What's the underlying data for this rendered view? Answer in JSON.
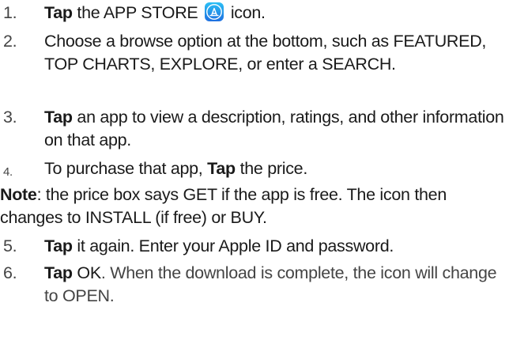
{
  "steps": [
    {
      "number": "1.",
      "parts": [
        "Tap",
        " the APP STORE ",
        " icon."
      ],
      "icon": "app-store-icon"
    },
    {
      "number": "2.",
      "text": "Choose a browse option at the bottom, such as FEATURED, TOP CHARTS, EXPLORE, or enter a SEARCH."
    },
    {
      "number": "3.",
      "parts": [
        "Tap",
        " an app to view a description, ratings, and other information on that app."
      ]
    },
    {
      "number": "4.",
      "parts": [
        "To purchase that app, ",
        "Tap",
        " the price."
      ]
    },
    {
      "number": "5.",
      "parts": [
        "Tap",
        " it again. Enter your Apple ID and password."
      ]
    },
    {
      "number": "6.",
      "parts": [
        "Tap",
        " OK",
        ". When the download is complete, the icon will change to OPEN."
      ]
    }
  ],
  "note": {
    "label": "Note",
    "text": ": the price box says GET if the app is free. The icon then changes to INSTALL (if free) or BUY."
  },
  "colors": {
    "text": "#1a1a1a",
    "number": "#444444",
    "icon_gradient_top": "#2bc0f5",
    "icon_gradient_bottom": "#1e6fe0"
  }
}
